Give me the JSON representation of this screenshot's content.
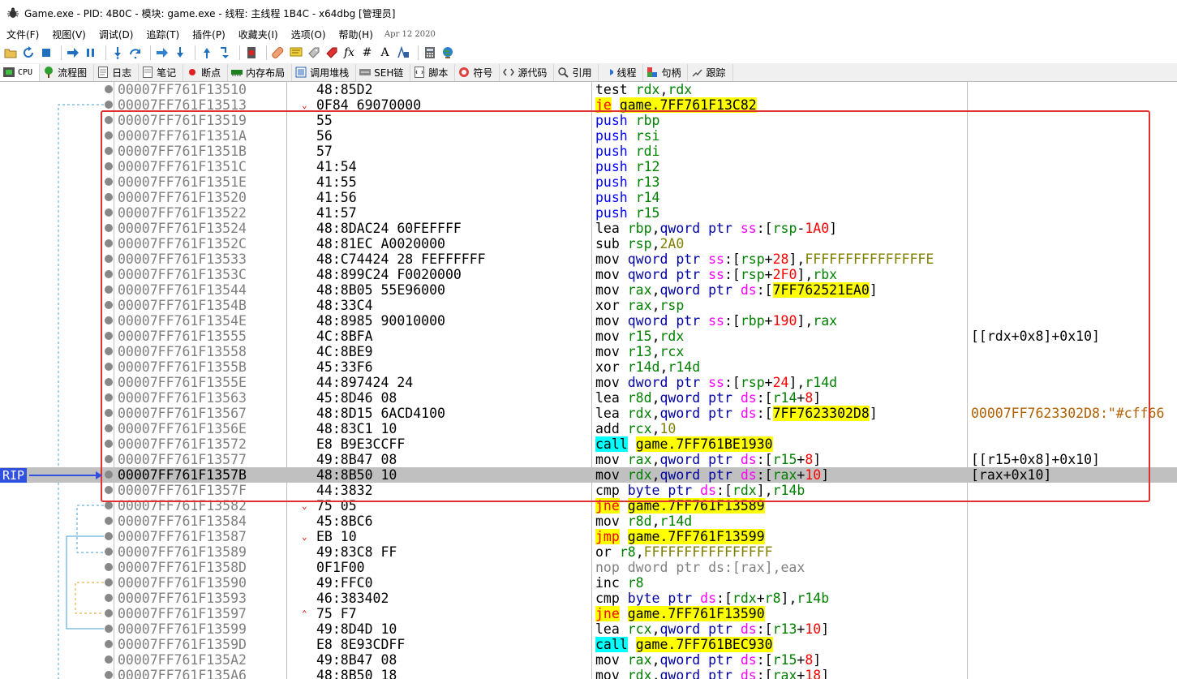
{
  "window": {
    "title": "Game.exe - PID: 4B0C - 模块: game.exe - 线程: 主线程 1B4C - x64dbg [管理员]"
  },
  "menu": {
    "items": [
      "文件(F)",
      "视图(V)",
      "调试(D)",
      "追踪(T)",
      "插件(P)",
      "收藏夹(I)",
      "选项(O)",
      "帮助(H)"
    ],
    "date": "Apr 12 2020"
  },
  "toolbar": {
    "icons": [
      "open-icon",
      "restart-icon",
      "stop-icon",
      "run-icon",
      "pause-icon",
      "step-into-icon",
      "step-over-icon",
      "trace-into-icon",
      "trace-over-icon",
      "run-to-user-code-icon",
      "step-out-icon",
      "breakpoint-icon",
      "patch-icon",
      "comment-icon",
      "label-icon",
      "bookmark-icon",
      "function-icon",
      "hash-icon",
      "font-icon",
      "text-icon",
      "calculator-icon",
      "globe-icon"
    ],
    "glyph_fx": "fx",
    "glyph_hash": "#",
    "glyph_a": "A"
  },
  "tabs": [
    {
      "label": "CPU",
      "icon": "cpu-icon",
      "active": true
    },
    {
      "label": "流程图",
      "icon": "graph-icon"
    },
    {
      "label": "日志",
      "icon": "log-icon"
    },
    {
      "label": "笔记",
      "icon": "notes-icon"
    },
    {
      "label": "断点",
      "icon": "breakpoint-dot-icon"
    },
    {
      "label": "内存布局",
      "icon": "memory-icon"
    },
    {
      "label": "调用堆栈",
      "icon": "callstack-icon"
    },
    {
      "label": "SEH链",
      "icon": "seh-icon"
    },
    {
      "label": "脚本",
      "icon": "script-icon"
    },
    {
      "label": "符号",
      "icon": "symbol-icon"
    },
    {
      "label": "源代码",
      "icon": "source-icon"
    },
    {
      "label": "引用",
      "icon": "references-icon"
    },
    {
      "label": "线程",
      "icon": "threads-icon"
    },
    {
      "label": "句柄",
      "icon": "handles-icon"
    },
    {
      "label": "跟踪",
      "icon": "trace-icon"
    }
  ],
  "rip_label": "RIP",
  "rows": [
    {
      "addr": "00007FF761F13510",
      "bytes": "48:85D2",
      "arrow": "",
      "comment": ""
    },
    {
      "addr": "00007FF761F13513",
      "bytes": "0F84 69070000",
      "arrow": "⌄",
      "comment": ""
    },
    {
      "addr": "00007FF761F13519",
      "bytes": "55",
      "arrow": "",
      "comment": ""
    },
    {
      "addr": "00007FF761F1351A",
      "bytes": "56",
      "arrow": "",
      "comment": ""
    },
    {
      "addr": "00007FF761F1351B",
      "bytes": "57",
      "arrow": "",
      "comment": ""
    },
    {
      "addr": "00007FF761F1351C",
      "bytes": "41:54",
      "arrow": "",
      "comment": ""
    },
    {
      "addr": "00007FF761F1351E",
      "bytes": "41:55",
      "arrow": "",
      "comment": ""
    },
    {
      "addr": "00007FF761F13520",
      "bytes": "41:56",
      "arrow": "",
      "comment": ""
    },
    {
      "addr": "00007FF761F13522",
      "bytes": "41:57",
      "arrow": "",
      "comment": ""
    },
    {
      "addr": "00007FF761F13524",
      "bytes": "48:8DAC24 60FEFFFF",
      "arrow": "",
      "comment": ""
    },
    {
      "addr": "00007FF761F1352C",
      "bytes": "48:81EC A0020000",
      "arrow": "",
      "comment": ""
    },
    {
      "addr": "00007FF761F13533",
      "bytes": "48:C74424 28 FEFFFFFF",
      "arrow": "",
      "comment": ""
    },
    {
      "addr": "00007FF761F1353C",
      "bytes": "48:899C24 F0020000",
      "arrow": "",
      "comment": ""
    },
    {
      "addr": "00007FF761F13544",
      "bytes": "48:8B05 55E96000",
      "arrow": "",
      "comment": ""
    },
    {
      "addr": "00007FF761F1354B",
      "bytes": "48:33C4",
      "arrow": "",
      "comment": ""
    },
    {
      "addr": "00007FF761F1354E",
      "bytes": "48:8985 90010000",
      "arrow": "",
      "comment": ""
    },
    {
      "addr": "00007FF761F13555",
      "bytes": "4C:8BFA",
      "arrow": "",
      "comment": "[[rdx+0x8]+0x10]"
    },
    {
      "addr": "00007FF761F13558",
      "bytes": "4C:8BE9",
      "arrow": "",
      "comment": ""
    },
    {
      "addr": "00007FF761F1355B",
      "bytes": "45:33F6",
      "arrow": "",
      "comment": ""
    },
    {
      "addr": "00007FF761F1355E",
      "bytes": "44:897424 24",
      "arrow": "",
      "comment": ""
    },
    {
      "addr": "00007FF761F13563",
      "bytes": "45:8D46 08",
      "arrow": "",
      "comment": ""
    },
    {
      "addr": "00007FF761F13567",
      "bytes": "48:8D15 6ACD4100",
      "arrow": "",
      "comment": "00007FF7623302D8:\"#cff66"
    },
    {
      "addr": "00007FF761F1356E",
      "bytes": "48:83C1 10",
      "arrow": "",
      "comment": ""
    },
    {
      "addr": "00007FF761F13572",
      "bytes": "E8 B9E3CCFF",
      "arrow": "",
      "comment": ""
    },
    {
      "addr": "00007FF761F13577",
      "bytes": "49:8B47 08",
      "arrow": "",
      "comment": "[[r15+0x8]+0x10]"
    },
    {
      "addr": "00007FF761F1357B",
      "bytes": "48:8B50 10",
      "arrow": "",
      "comment": "[rax+0x10]"
    },
    {
      "addr": "00007FF761F1357F",
      "bytes": "44:3832",
      "arrow": "",
      "comment": ""
    },
    {
      "addr": "00007FF761F13582",
      "bytes": "75 05",
      "arrow": "⌄",
      "comment": ""
    },
    {
      "addr": "00007FF761F13584",
      "bytes": "45:8BC6",
      "arrow": "",
      "comment": ""
    },
    {
      "addr": "00007FF761F13587",
      "bytes": "EB 10",
      "arrow": "⌄",
      "comment": ""
    },
    {
      "addr": "00007FF761F13589",
      "bytes": "49:83C8 FF",
      "arrow": "",
      "comment": ""
    },
    {
      "addr": "00007FF761F1358D",
      "bytes": "0F1F00",
      "arrow": "",
      "comment": ""
    },
    {
      "addr": "00007FF761F13590",
      "bytes": "49:FFC0",
      "arrow": "",
      "comment": ""
    },
    {
      "addr": "00007FF761F13593",
      "bytes": "46:383402",
      "arrow": "",
      "comment": ""
    },
    {
      "addr": "00007FF761F13597",
      "bytes": "75 F7",
      "arrow": "⌃",
      "comment": ""
    },
    {
      "addr": "00007FF761F13599",
      "bytes": "49:8D4D 10",
      "arrow": "",
      "comment": ""
    },
    {
      "addr": "00007FF761F1359D",
      "bytes": "E8 8E93CDFF",
      "arrow": "",
      "comment": ""
    },
    {
      "addr": "00007FF761F135A2",
      "bytes": "49:8B47 08",
      "arrow": "",
      "comment": ""
    },
    {
      "addr": "00007FF761F135A6",
      "bytes": "48:8B50 18",
      "arrow": "",
      "comment": ""
    }
  ],
  "instructions": [
    "test rdx,rdx",
    "je game.7FF761F13C82",
    "push rbp",
    "push rsi",
    "push rdi",
    "push r12",
    "push r13",
    "push r14",
    "push r15",
    "lea rbp,qword ptr ss:[rsp-1A0]",
    "sub rsp,2A0",
    "mov qword ptr ss:[rsp+28],FFFFFFFFFFFFFFFE",
    "mov qword ptr ss:[rsp+2F0],rbx",
    "mov rax,qword ptr ds:[7FF762521EA0]",
    "xor rax,rsp",
    "mov qword ptr ss:[rbp+190],rax",
    "mov r15,rdx",
    "mov r13,rcx",
    "xor r14d,r14d",
    "mov dword ptr ss:[rsp+24],r14d",
    "lea r8d,qword ptr ds:[r14+8]",
    "lea rdx,qword ptr ds:[7FF7623302D8]",
    "add rcx,10",
    "call game.7FF761BE1930",
    "mov rax,qword ptr ds:[r15+8]",
    "mov rdx,qword ptr ds:[rax+10]",
    "cmp byte ptr ds:[rdx],r14b",
    "jne game.7FF761F13589",
    "mov r8d,r14d",
    "jmp game.7FF761F13599",
    "or r8,FFFFFFFFFFFFFFFF",
    "nop dword ptr ds:[rax],eax",
    "inc r8",
    "cmp byte ptr ds:[rdx+r8],r14b",
    "jne game.7FF761F13590",
    "lea rcx,qword ptr ds:[r13+10]",
    "call game.7FF761BEC930",
    "mov rax,qword ptr ds:[r15+8]",
    "mov rdx,qword ptr ds:[rax+18]"
  ],
  "rip_row_index": 25,
  "colors": {
    "highlight_box": "#e03030",
    "rip_background": "#c0c0c0",
    "rip_label": "#3050e0",
    "jump_target_yellow": "#ffff00",
    "call_cyan": "#00ffff"
  }
}
